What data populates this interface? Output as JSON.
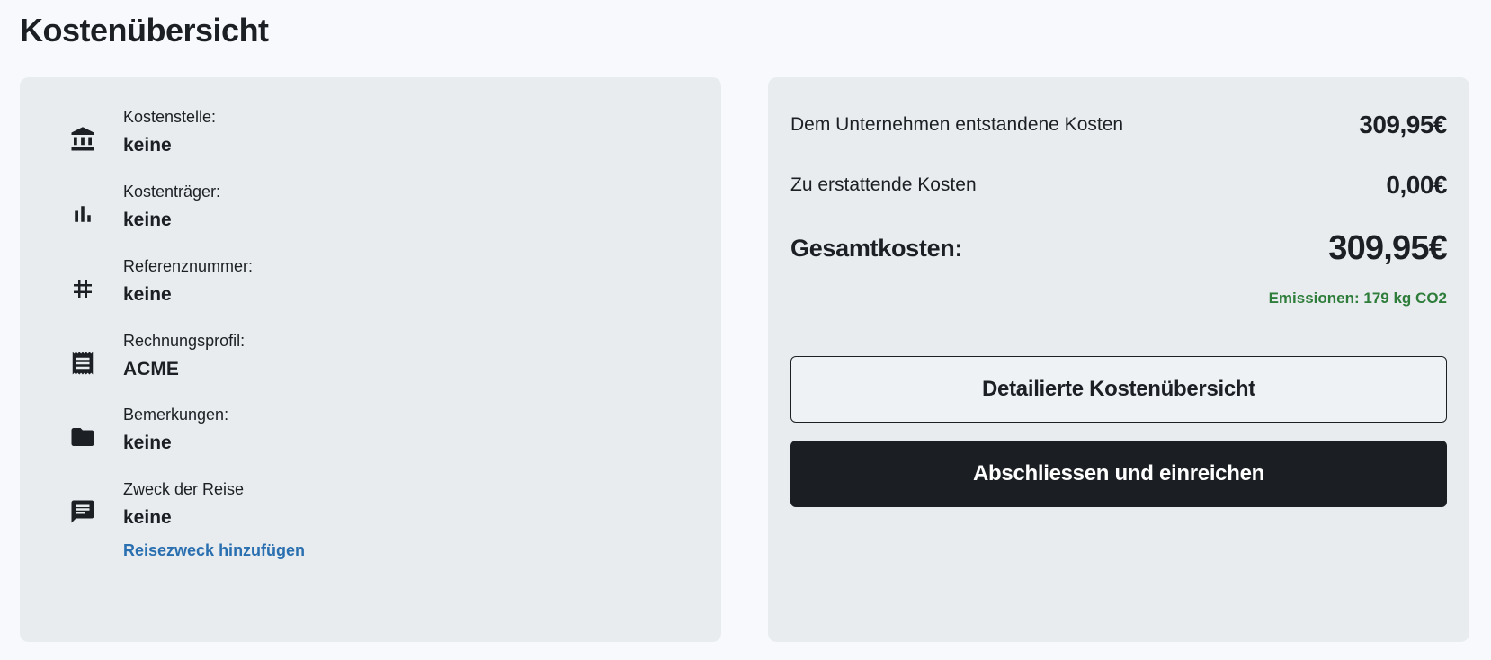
{
  "page": {
    "title": "Kostenübersicht"
  },
  "details": {
    "items": [
      {
        "icon": "bank-icon",
        "label": "Kostenstelle:",
        "value": "keine"
      },
      {
        "icon": "bar-chart-icon",
        "label": "Kostenträger:",
        "value": "keine"
      },
      {
        "icon": "hash-icon",
        "label": "Referenznummer:",
        "value": "keine"
      },
      {
        "icon": "receipt-icon",
        "label": "Rechnungsprofil:",
        "value": "ACME"
      },
      {
        "icon": "folder-icon",
        "label": "Bemerkungen:",
        "value": "keine"
      },
      {
        "icon": "chat-icon",
        "label": "Zweck der Reise",
        "value": "keine",
        "link": "Reisezweck hinzufügen"
      }
    ]
  },
  "summary": {
    "company_costs_label": "Dem Unternehmen entstandene Kosten",
    "company_costs_value": "309,95€",
    "refund_label": "Zu erstattende Kosten",
    "refund_value": "0,00€",
    "total_label": "Gesamtkosten:",
    "total_value": "309,95€",
    "emissions": "Emissionen: 179 kg CO2",
    "detail_button": "Detailierte Kostenübersicht",
    "submit_button": "Abschliessen und einreichen"
  },
  "colors": {
    "background": "#f7f9fc",
    "card": "#e8ecef",
    "link": "#2a6fb0",
    "emissions": "#2e7d3a",
    "primary_button": "#1b1f23"
  }
}
